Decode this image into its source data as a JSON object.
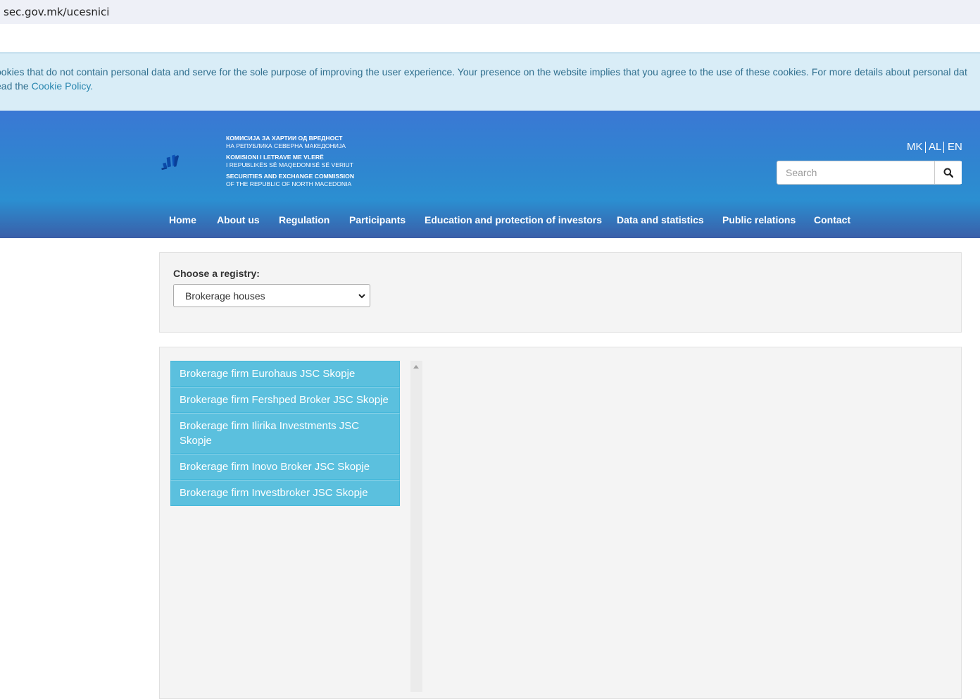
{
  "browser": {
    "url": "sec.gov.mk/ucesnici"
  },
  "cookie_notice": {
    "line1": "ookies that do not contain personal data and serve for the sole purpose of improving the user experience. Your presence on the website implies that you agree to the use of these cookies. For more details about personal dat",
    "line2_prefix": "ead the ",
    "link_text": "Cookie Policy."
  },
  "logo": {
    "icon": "sec-logo-icon",
    "lines": [
      "КОМИСИЈА ЗА ХАРТИИ ОД ВРЕДНОСТ",
      "НА РЕПУБЛИКА СЕВЕРНА МАКЕДОНИЈА",
      "KOMISIONI I LETRAVE ME VLERË",
      "I REPUBLIKËS SË MAQEDONISË SË VERIUT",
      "SECURITIES AND EXCHANGE COMMISSION",
      "OF THE REPUBLIC OF NORTH MACEDONIA"
    ]
  },
  "languages": [
    "MK",
    "AL",
    "EN"
  ],
  "search": {
    "placeholder": "Search",
    "icon": "search-icon"
  },
  "nav": [
    "Home",
    "About us",
    "Regulation",
    "Participants",
    "Education and protection of investors",
    "Data and statistics",
    "Public relations",
    "Contact"
  ],
  "registry": {
    "label": "Choose a registry:",
    "selected": "Brokerage houses"
  },
  "list": [
    "Brokerage firm Eurohaus JSC Skopje",
    "Brokerage firm Fershped Broker JSC Skopje",
    "Brokerage firm Ilirika Investments JSC Skopje",
    "Brokerage firm Inovo Broker JSC Skopje",
    "Brokerage firm Investbroker JSC Skopje"
  ],
  "colors": {
    "header_top": "#3a78d4",
    "header_bottom": "#3a5ea8",
    "cookie_bg": "#d9edf7",
    "list_item_bg": "#5bc0de",
    "panel_bg": "#f4f4f4"
  }
}
